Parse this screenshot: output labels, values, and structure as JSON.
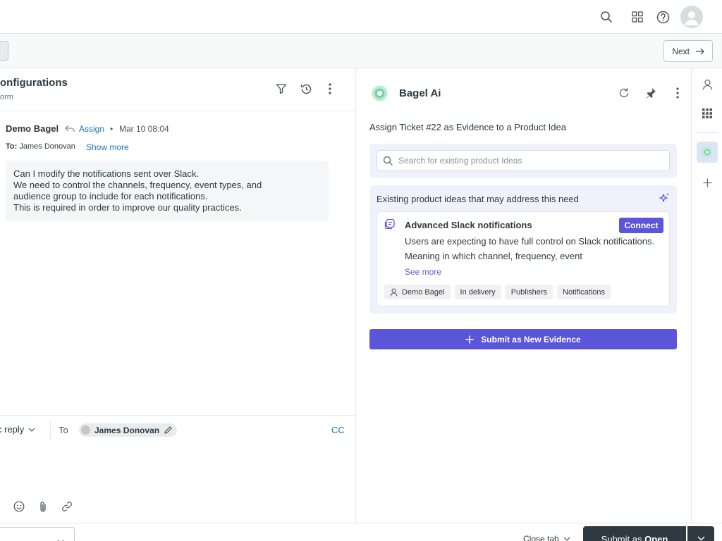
{
  "topbar": {
    "icons": [
      "search-icon",
      "apps-grid-icon",
      "help-icon",
      "user-avatar"
    ]
  },
  "subbar": {
    "next_label": "Next"
  },
  "ticket": {
    "title": "onfigurations",
    "subtitle": "orm",
    "message": {
      "author": "Demo Bagel",
      "assign_label": "Assign",
      "separator": "•",
      "date": "Mar 10 08:04",
      "to_prefix": "To:",
      "to_name": "James Donovan",
      "show_more_label": "Show more",
      "body_lines": [
        "Can I modify the notifications sent over Slack.",
        "We need to control the channels, frequency, event types, and",
        "audience group to include for each notifications.",
        "This is required in order to improve our quality practices."
      ]
    }
  },
  "reply": {
    "type_label": "c reply",
    "to_label": "To",
    "recipient": "James Donovan",
    "cc_label": "CC"
  },
  "bagel": {
    "title": "Bagel Ai",
    "assign_heading": "Assign Ticket #22 as Evidence to a Product Idea",
    "search_placeholder": "Search for existing product Ideas",
    "ideas_heading": "Existing product ideas that may address this need",
    "idea": {
      "title": "Advanced Slack notifications",
      "connect_label": "Connect",
      "description": "Users are expecting to have full control on Slack notifications. Meaning in which channel, frequency, event",
      "see_more_label": "See more",
      "tags": [
        "Demo Bagel",
        "In delivery",
        "Publishers",
        "Notifications"
      ]
    },
    "submit_label": "Submit as New Evidence",
    "colors": {
      "accent": "#5b56d9",
      "panel_bg": "#f1f1fb",
      "logo": "#7dd3a8"
    }
  },
  "footer": {
    "close_tab_label": "Close tab",
    "submit_prefix": "Submit as ",
    "submit_status": "Open"
  }
}
